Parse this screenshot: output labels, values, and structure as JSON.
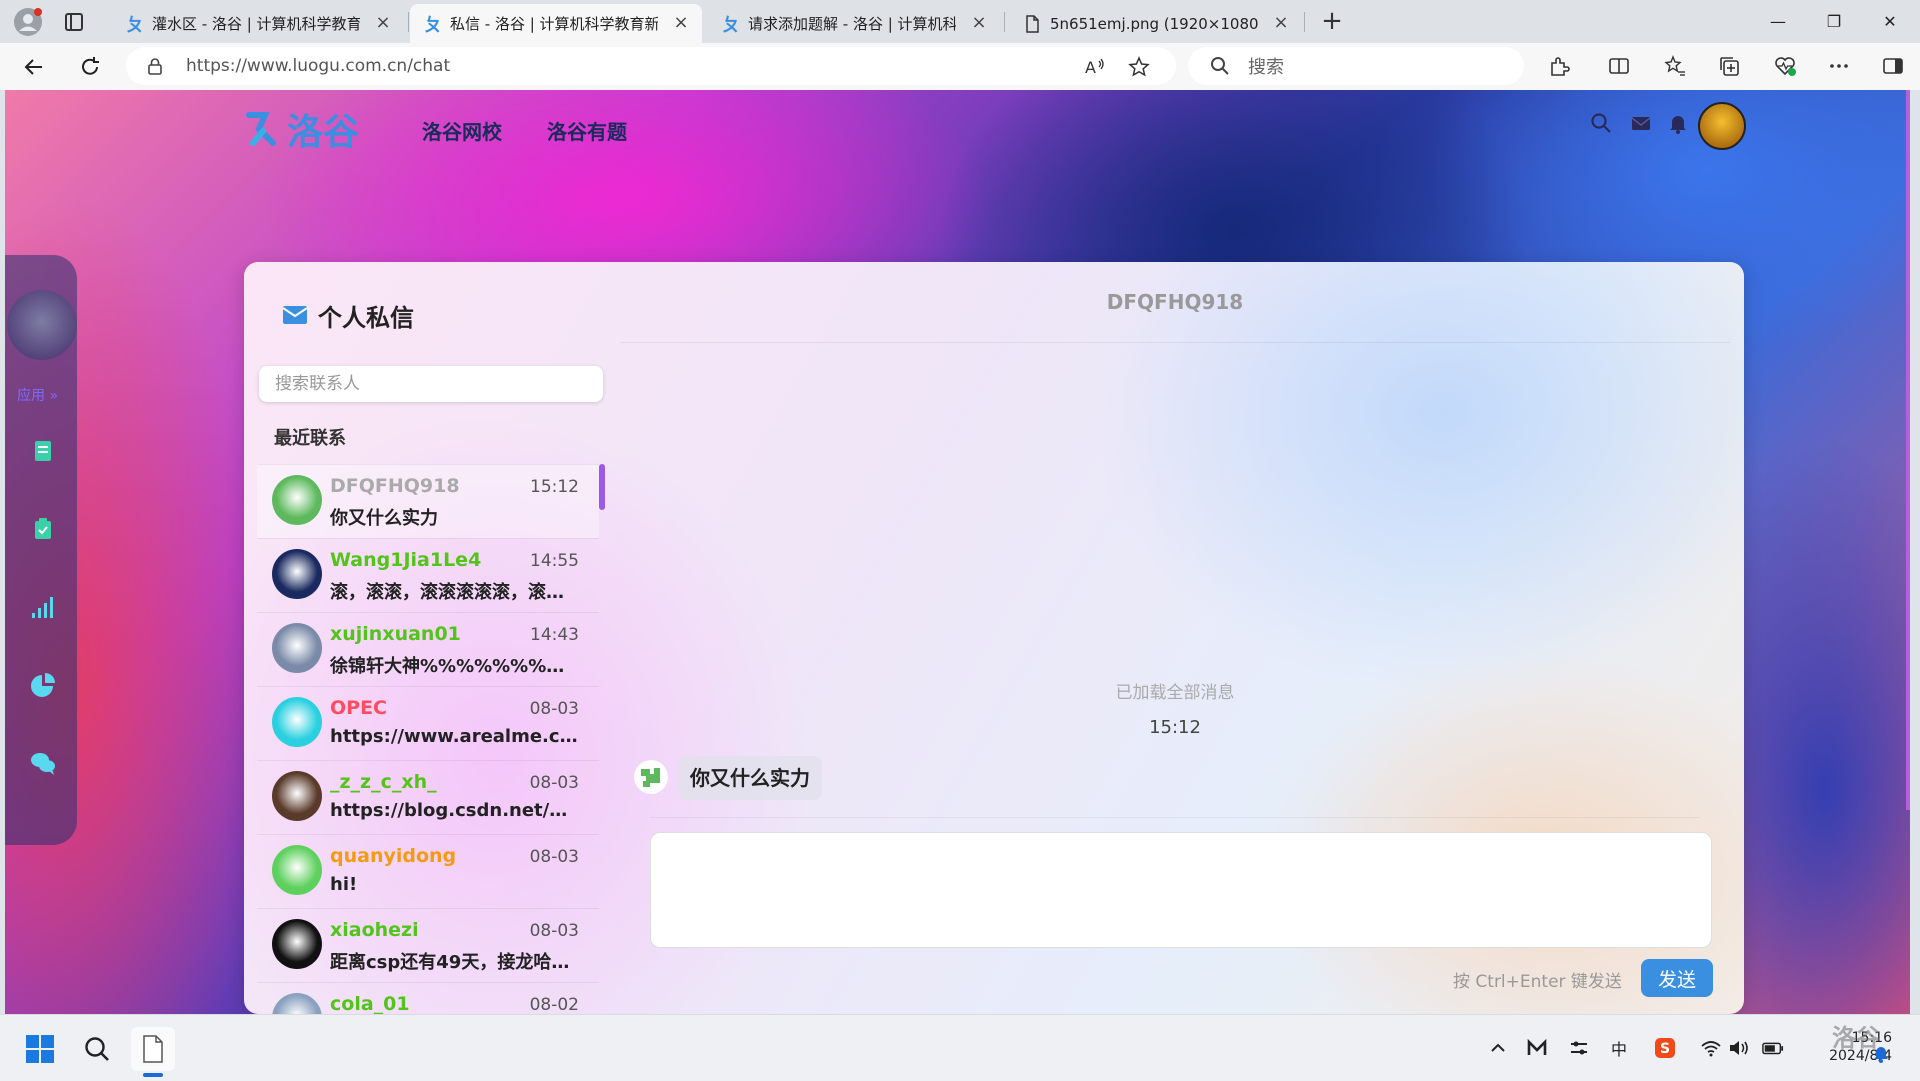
{
  "browser": {
    "tabs": [
      {
        "title": "灌水区 - 洛谷 | 计算机科学教育新",
        "active": false
      },
      {
        "title": "私信 - 洛谷 | 计算机科学教育新生",
        "active": true
      },
      {
        "title": "请求添加题解 - 洛谷 | 计算机科学",
        "active": false
      },
      {
        "title": "5n651emj.png (1920×1080)",
        "active": false
      }
    ],
    "new_tab": "+",
    "url": "https://www.luogu.com.cn/chat",
    "search_placeholder": "搜索",
    "window_controls": {
      "minimize": "—",
      "restore": "❐",
      "close": "✕"
    }
  },
  "site": {
    "logo_text": "洛谷",
    "nav": [
      "洛谷网校",
      "洛谷有题"
    ],
    "rail_label": "应用 »"
  },
  "chat": {
    "title": "个人私信",
    "search_placeholder": "搜索联系人",
    "recent_label": "最近联系",
    "contacts": [
      {
        "name": "DFQFHQ918",
        "time": "15:12",
        "message": "你又什么实力",
        "name_color": "#aaaaaa",
        "avatar_color": "#5eb95e"
      },
      {
        "name": "Wang1Jia1Le4",
        "time": "14:55",
        "message": "滚，滚滚，滚滚滚滚滚，滚…",
        "name_color": "#52c41a",
        "avatar_color": "#1a2a60"
      },
      {
        "name": "xujinxuan01",
        "time": "14:43",
        "message": "徐锦轩大神%%%%%%%%%...",
        "name_color": "#52c41a",
        "avatar_color": "#7a8aa8"
      },
      {
        "name": "OPEC",
        "time": "08-03",
        "message": "https://www.arealme.com/...",
        "name_color": "#fe4c61",
        "avatar_color": "#2ad0e0"
      },
      {
        "name": "_z_z_c_xh_",
        "time": "08-03",
        "message": "https://blog.csdn.net/weix...",
        "name_color": "#52c41a",
        "avatar_color": "#5a3a2a"
      },
      {
        "name": "quanyidong",
        "time": "08-03",
        "message": "hi!",
        "name_color": "#f39c11",
        "avatar_color": "#5ed05e"
      },
      {
        "name": "xiaohezi",
        "time": "08-03",
        "message": "距离csp还有49天，接龙哈！...",
        "name_color": "#52c41a",
        "avatar_color": "#111111"
      },
      {
        "name": "cola_01",
        "time": "08-02",
        "message": "",
        "name_color": "#52c41a",
        "avatar_color": "#8aa0c0"
      }
    ],
    "conversation": {
      "title": "DFQFHQ918",
      "loaded_note": "已加载全部消息",
      "time": "15:12",
      "message": "你又什么实力",
      "compose_value": "",
      "send_hint": "按 Ctrl+Enter 键发送",
      "send_label": "发送"
    }
  },
  "taskbar": {
    "clock_time": "15:16",
    "clock_date": "2024/8/4",
    "ime": "中",
    "watermark": "洛谷"
  }
}
